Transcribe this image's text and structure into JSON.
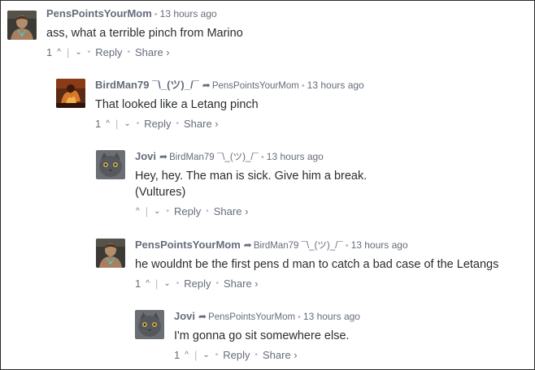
{
  "comments": [
    {
      "author": "PensPointsYourMom",
      "parent": "",
      "time": "13 hours ago",
      "lines": [
        "ass, what a terrible pinch from Marino"
      ],
      "votes": "1",
      "avatar": "hockey-man"
    },
    {
      "author": "BirdMan79 ¯\\_(ツ)_/¯",
      "parent": "PensPointsYourMom",
      "time": "13 hours ago",
      "lines": [
        "That looked like a Letang pinch"
      ],
      "votes": "1",
      "avatar": "bird-fire"
    },
    {
      "author": "Jovi",
      "parent": "BirdMan79 ¯\\_(ツ)_/¯",
      "time": "13 hours ago",
      "lines": [
        "Hey, hey. The man is sick. Give him a break.",
        "(Vultures)"
      ],
      "votes": "",
      "avatar": "gray-cat"
    },
    {
      "author": "PensPointsYourMom",
      "parent": "BirdMan79 ¯\\_(ツ)_/¯",
      "time": "13 hours ago",
      "lines": [
        "he wouldnt be the first pens d man to catch a bad case of the Letangs"
      ],
      "votes": "1",
      "avatar": "hockey-man"
    },
    {
      "author": "Jovi",
      "parent": "PensPointsYourMom",
      "time": "13 hours ago",
      "lines": [
        "I'm gonna go sit somewhere else."
      ],
      "votes": "1",
      "avatar": "gray-cat"
    }
  ],
  "labels": {
    "reply": "Reply",
    "share": "Share ›",
    "upvote": "^",
    "downvote": "⌄",
    "separator": "|",
    "dot": "•"
  },
  "colors": {
    "meta": "#656c7a",
    "text": "#2a2e2e",
    "separator": "#b7bbc1"
  }
}
